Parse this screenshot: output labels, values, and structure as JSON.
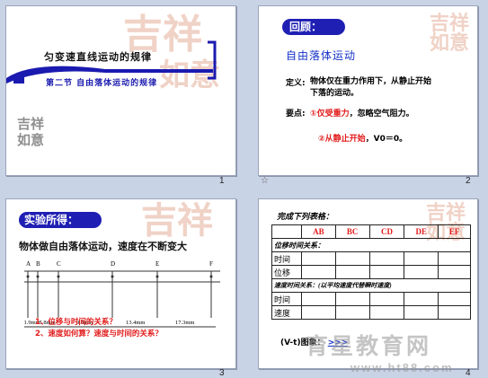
{
  "slide1": {
    "title": "匀变速直线运动的规律",
    "subtitle": "第二节 自由落体运动的规律",
    "number": "1"
  },
  "slide2": {
    "header": "回顾：",
    "topic": "自由落体运动",
    "def_label": "定义:",
    "def_text": "物体仅在重力作用下，从静止开始下落的运动。",
    "key_label": "要点:",
    "point1_marker": "①",
    "point1_red": "仅受重力",
    "point1_rest": "，忽略空气阻力。",
    "point2_marker": "②",
    "point2_red": "从静止开始",
    "point2_rest": "，V0＝0。",
    "number": "2",
    "nav_icon": "☆"
  },
  "slide3": {
    "header": "实验所得：",
    "statement": "物体做自由落体运动，速度在不断变大",
    "points": [
      "A",
      "B",
      "C",
      "D",
      "E",
      "F"
    ],
    "distances": [
      "1.9mm",
      "5.8mm",
      "9.6mm",
      "13.4mm",
      "17.3mm"
    ],
    "question1": "1、位移与时间的关系？",
    "question2": "2、速度如何算？速度与时间的关系？",
    "number": "3"
  },
  "slide4": {
    "title": "完成下列表格：",
    "columns": [
      "AB",
      "BC",
      "CD",
      "DE",
      "EF"
    ],
    "row_section1": "位移时间关系：",
    "row_time": "时间",
    "row_disp": "位移",
    "row_section2": "速度时间关系：(以平均速度代替瞬时速度)",
    "row_time2": "时间",
    "row_speed": "速度",
    "graph_label": "(V-t)图象：",
    "graph_link": ">>>",
    "number": "4"
  },
  "watermark": {
    "text": "育星教育网",
    "url": "www.ht88.com",
    "logo": "吉祥如意"
  }
}
